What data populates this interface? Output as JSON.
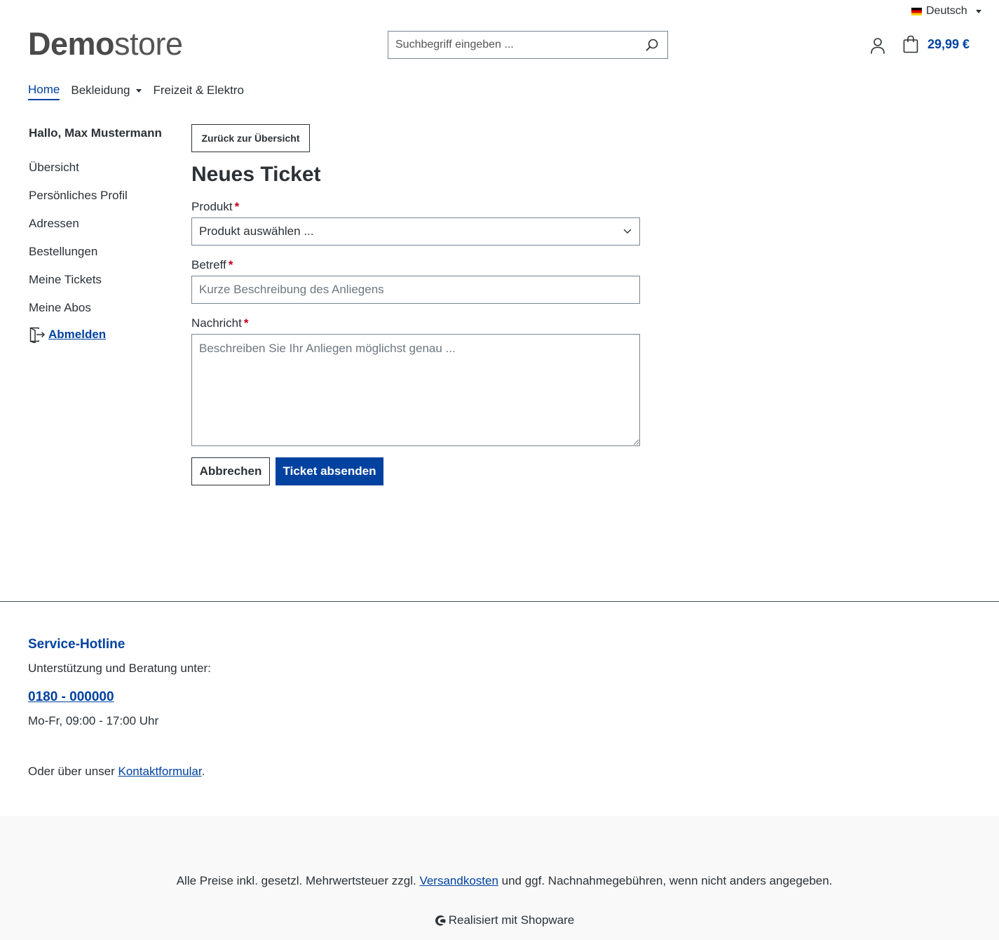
{
  "topbar": {
    "language": "Deutsch"
  },
  "header": {
    "logo_bold": "Demo",
    "logo_light": "store",
    "search_placeholder": "Suchbegriff eingeben ...",
    "cart_total": "29,99 €"
  },
  "nav": {
    "items": [
      {
        "label": "Home",
        "active": true
      },
      {
        "label": "Bekleidung",
        "has_dropdown": true
      },
      {
        "label": "Freizeit & Elektro"
      }
    ]
  },
  "sidebar": {
    "greeting": "Hallo, Max Mustermann",
    "items": [
      {
        "label": "Übersicht"
      },
      {
        "label": "Persönliches Profil"
      },
      {
        "label": "Adressen"
      },
      {
        "label": "Bestellungen"
      },
      {
        "label": "Meine Tickets"
      },
      {
        "label": "Meine Abos"
      }
    ],
    "logout": "Abmelden"
  },
  "content": {
    "back_button": "Zurück zur Übersicht",
    "title": "Neues Ticket",
    "product_label": "Produkt",
    "product_select_value": "Produkt auswählen ...",
    "subject_label": "Betreff",
    "subject_placeholder": "Kurze Beschreibung des Anliegens",
    "message_label": "Nachricht",
    "message_placeholder": "Beschreiben Sie Ihr Anliegen möglichst genau ...",
    "required_mark": "*",
    "cancel_button": "Abbrechen",
    "submit_button": "Ticket absenden"
  },
  "footer": {
    "hotline_title": "Service-Hotline",
    "hotline_text": "Unterstützung und Beratung unter:",
    "hotline_phone": "0180 - 000000",
    "hotline_hours": "Mo-Fr, 09:00 - 17:00 Uhr",
    "contact_prefix": "Oder über unser ",
    "contact_link": "Kontaktformular",
    "contact_suffix": ".",
    "vat_prefix": "Alle Preise inkl. gesetzl. Mehrwertsteuer zzgl. ",
    "vat_link": "Versandkosten",
    "vat_suffix": " und ggf. Nachnahmegebühren, wenn nicht anders angegeben.",
    "powered": "Realisiert mit Shopware"
  },
  "colors": {
    "accent": "#0042a0",
    "text": "#2b3136",
    "required": "#c20017",
    "footer_bg": "#f9f9f9"
  },
  "icons": [
    "flag-de-icon",
    "chevron-down-icon",
    "search-icon",
    "user-icon",
    "cart-icon",
    "logout-icon",
    "shopware-icon"
  ]
}
